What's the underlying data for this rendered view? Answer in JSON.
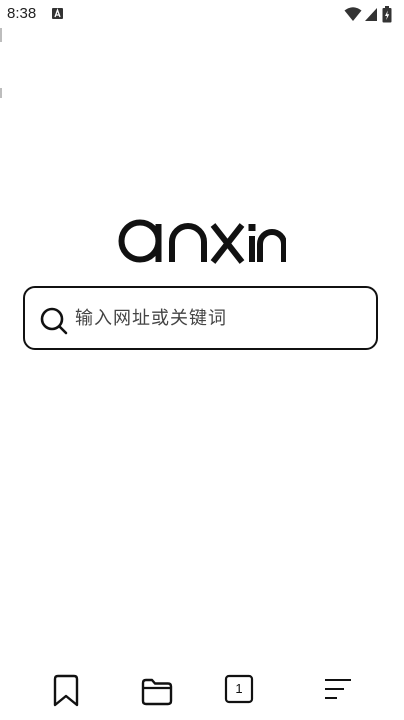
{
  "status_bar": {
    "time": "8:38",
    "icons": [
      "notification-app-icon",
      "wifi-icon",
      "cell-signal-icon",
      "battery-icon"
    ]
  },
  "logo": {
    "text": "anxin"
  },
  "search": {
    "placeholder": "输入网址或关键词",
    "value": "",
    "icon": "search-icon"
  },
  "bottom_nav": {
    "bookmarks_icon": "bookmark-icon",
    "files_icon": "folder-icon",
    "tabs_count": "1",
    "menu_icon": "menu-icon"
  },
  "colors": {
    "background": "#ffffff",
    "foreground": "#111111"
  }
}
